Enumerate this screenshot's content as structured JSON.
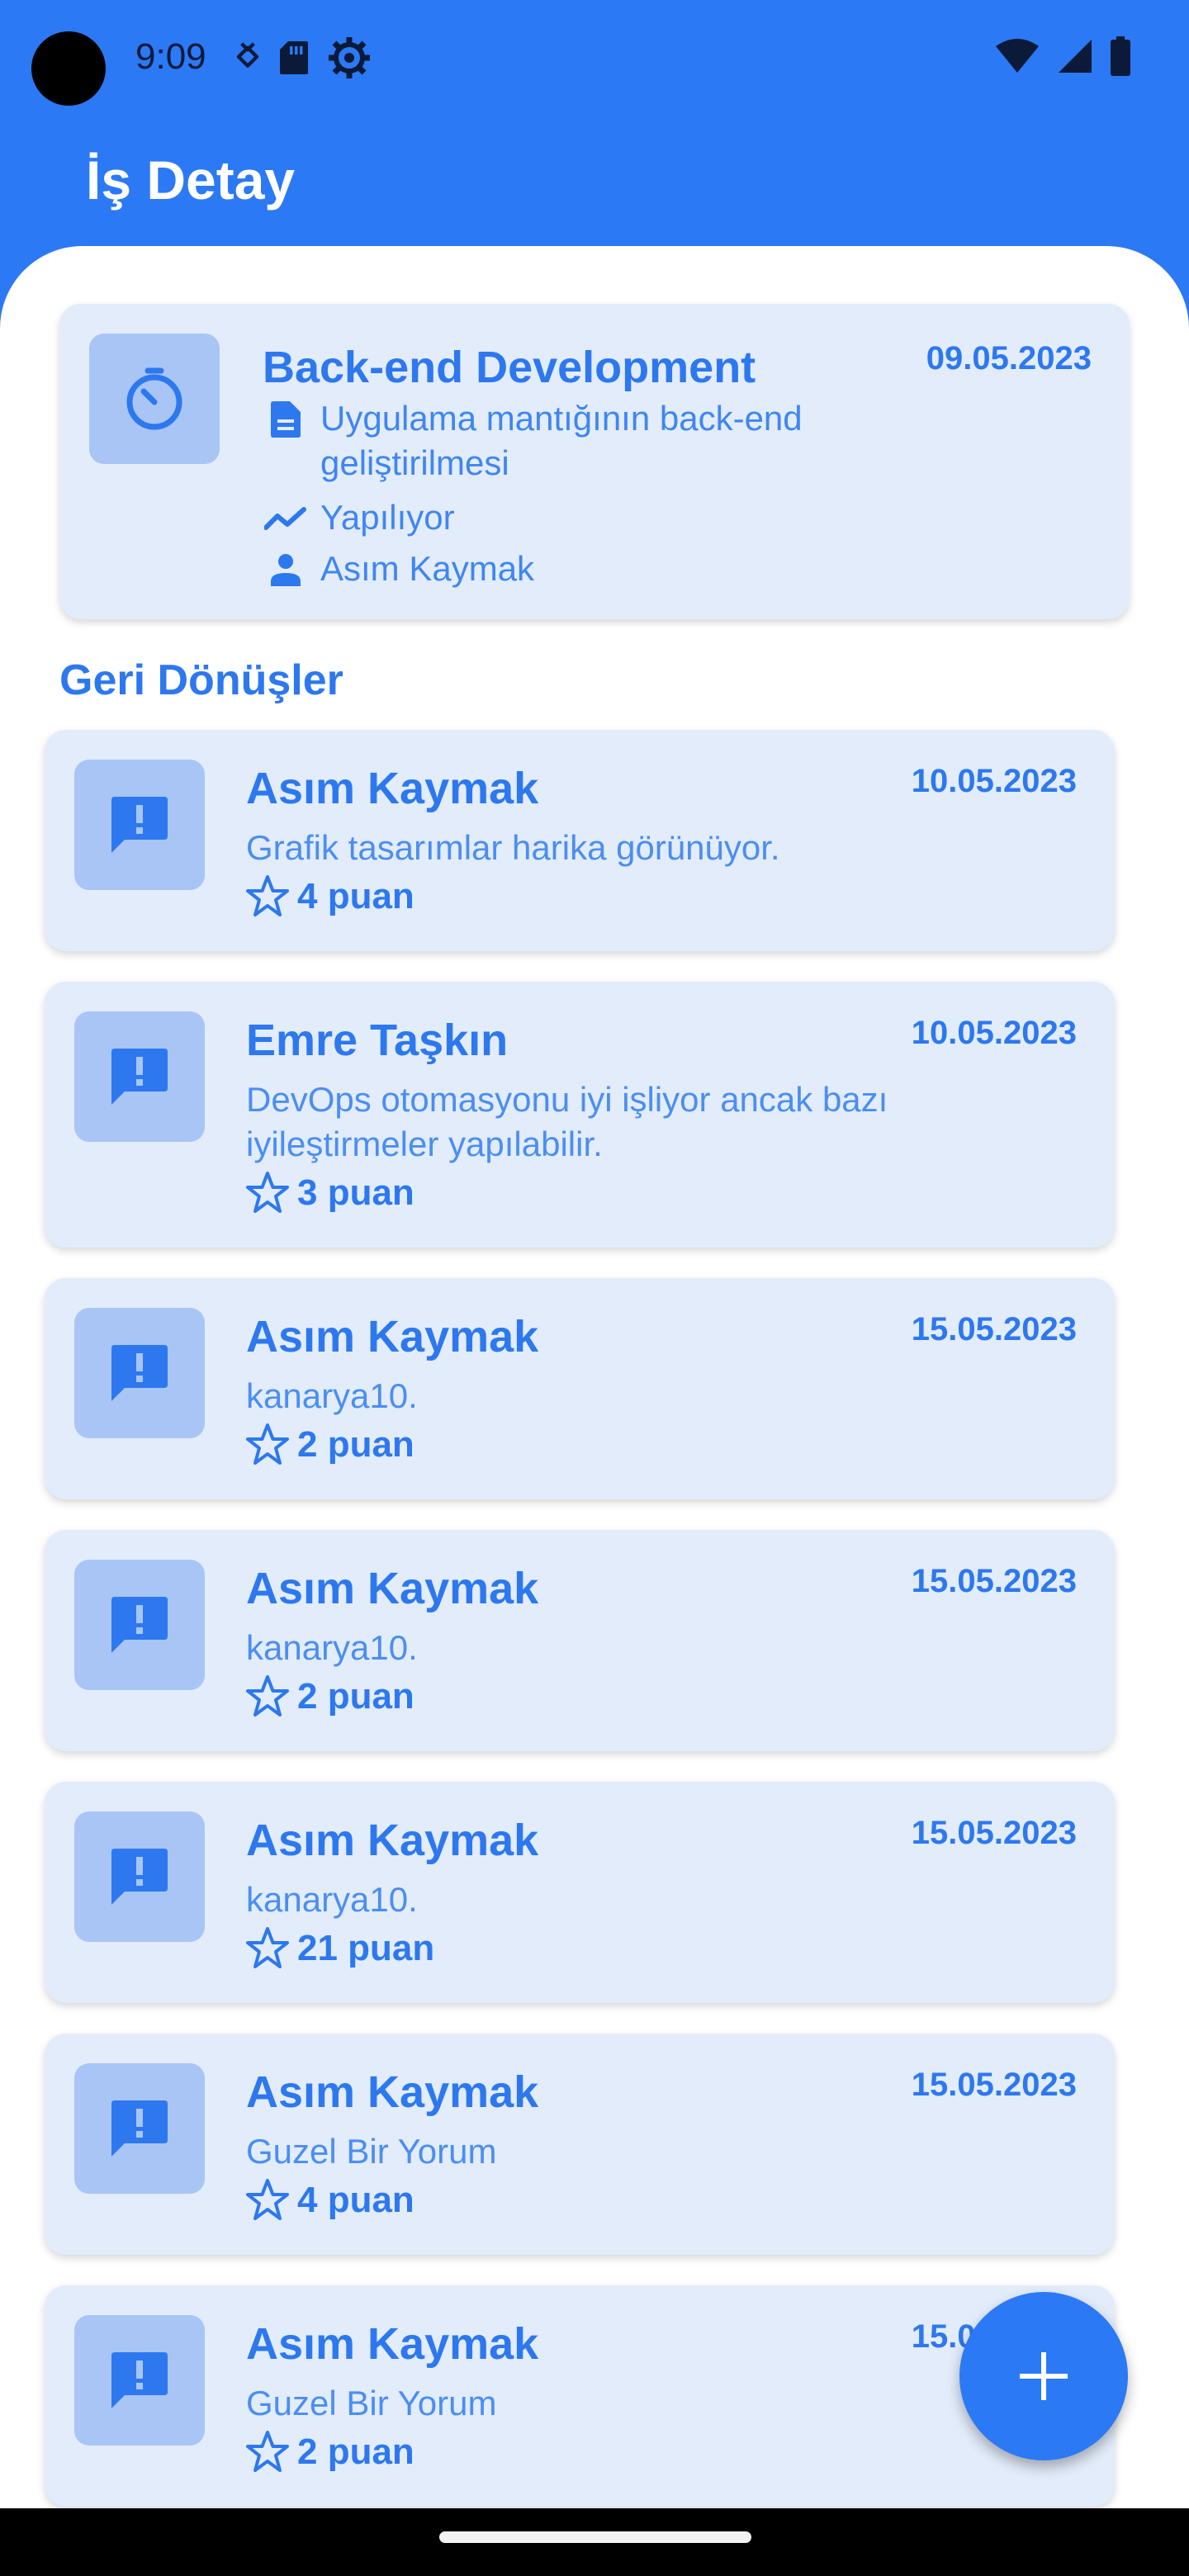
{
  "status_bar": {
    "time": "9:09",
    "left_icons": [
      "download-status-icon",
      "sd-card-icon",
      "settings-gear-icon"
    ],
    "right_icons": [
      "wifi-icon",
      "signal-icon",
      "battery-icon"
    ]
  },
  "header": {
    "title": "İş Detay"
  },
  "task": {
    "icon": "timer-icon",
    "title": "Back-end Development",
    "date": "09.05.2023",
    "description": "Uygulama mantığının back-end geliştirilmesi",
    "status": "Yapılıyor",
    "assignee": "Asım Kaymak"
  },
  "feedback_section": {
    "title": "Geri Dönüşler"
  },
  "feedback": [
    {
      "name": "Asım Kaymak",
      "date": "10.05.2023",
      "comment": "Grafik tasarımlar harika görünüyor.",
      "rating": "4 puan"
    },
    {
      "name": "Emre Taşkın",
      "date": "10.05.2023",
      "comment": "DevOps otomasyonu iyi işliyor ancak bazı iyileştirmeler yapılabilir.",
      "rating": "3 puan"
    },
    {
      "name": "Asım Kaymak",
      "date": "15.05.2023",
      "comment": "kanarya10.",
      "rating": "2 puan"
    },
    {
      "name": "Asım Kaymak",
      "date": "15.05.2023",
      "comment": "kanarya10.",
      "rating": "2 puan"
    },
    {
      "name": "Asım Kaymak",
      "date": "15.05.2023",
      "comment": "kanarya10.",
      "rating": "21 puan"
    },
    {
      "name": "Asım Kaymak",
      "date": "15.05.2023",
      "comment": "Guzel Bir Yorum",
      "rating": "4 puan"
    },
    {
      "name": "Asım Kaymak",
      "date": "15.05.2023",
      "comment": "Guzel Bir Yorum",
      "rating": "2 puan"
    }
  ],
  "fab": {
    "icon": "plus-icon"
  },
  "colors": {
    "primary": "#2B79F5",
    "card": "#E3ECFB",
    "tile": "#A8C5F6",
    "text": "#2D78EF"
  }
}
